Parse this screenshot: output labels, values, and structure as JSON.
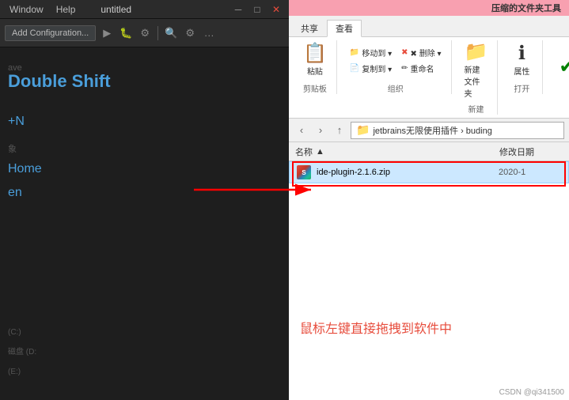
{
  "window": {
    "title": "untitled",
    "menu_items": [
      "Window",
      "Help"
    ]
  },
  "ide": {
    "toolbar": {
      "add_config_label": "Add Configuration..."
    },
    "actions": [
      {
        "id": "search_everywhere",
        "label": "Double Shift",
        "prefix": ""
      },
      {
        "id": "new_file",
        "label": "+N",
        "prefix": ""
      },
      {
        "id": "go_home",
        "label": "Home",
        "prefix": ""
      },
      {
        "id": "other",
        "label": "en",
        "prefix": ""
      }
    ]
  },
  "explorer": {
    "ribbon": {
      "tabs": [
        "共享",
        "查看"
      ],
      "active_section": "压缩的文件夹工具",
      "groups": [
        {
          "label": "剪贴板",
          "buttons": [
            {
              "id": "paste",
              "label": "粘贴",
              "icon": "📋",
              "large": true
            }
          ]
        },
        {
          "label": "组织",
          "buttons": [
            {
              "id": "move_to",
              "label": "移动到 ▾",
              "icon": "📁"
            },
            {
              "id": "delete",
              "label": "✖ 删除 ▾",
              "icon": ""
            },
            {
              "id": "copy_to",
              "label": "复制到 ▾",
              "icon": "📄"
            },
            {
              "id": "rename",
              "label": "重命名",
              "icon": "✏️"
            }
          ]
        },
        {
          "label": "新建",
          "buttons": [
            {
              "id": "new_folder",
              "label": "新建文件夹",
              "icon": "📁",
              "large": true
            },
            {
              "id": "properties",
              "label": "属性",
              "icon": "ℹ️",
              "large": true
            }
          ]
        },
        {
          "label": "打开",
          "buttons": [
            {
              "id": "checkmark",
              "label": "✔",
              "icon": ""
            }
          ]
        }
      ]
    },
    "address": {
      "path_parts": [
        "jetbrains无限使用插件",
        "buding"
      ],
      "full_path": "jetbrains无限使用插件 › buding"
    },
    "columns": {
      "name": "名称",
      "modified_date": "修改日期"
    },
    "files": [
      {
        "id": "ide-plugin-zip",
        "name": "ide-plugin-2.1.6.zip",
        "icon_type": "zip",
        "modified": "2020-1"
      }
    ],
    "drives": [
      {
        "label": "(C:)"
      },
      {
        "label": "磁盘 (D:"
      },
      {
        "label": "(E:)"
      }
    ]
  },
  "instruction": {
    "text": "鼠标左键直接拖拽到软件中"
  },
  "watermark": {
    "text": "CSDN @qi341500"
  }
}
